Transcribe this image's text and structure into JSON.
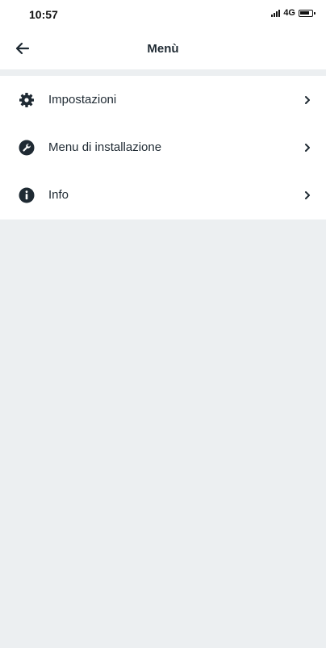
{
  "status_bar": {
    "time": "10:57",
    "network": "4G",
    "icons": [
      "signal-icon",
      "battery-icon"
    ]
  },
  "header": {
    "title": "Menù",
    "back_icon": "arrow-left-icon"
  },
  "menu": {
    "items": [
      {
        "label": "Impostazioni",
        "icon": "gear-icon"
      },
      {
        "label": "Menu di installazione",
        "icon": "wrench-icon"
      },
      {
        "label": "Info",
        "icon": "info-icon"
      }
    ],
    "chevron_icon": "chevron-right-icon"
  },
  "colors": {
    "text": "#1f2a33",
    "background": "#ffffff",
    "empty_area": "#eceff1"
  }
}
